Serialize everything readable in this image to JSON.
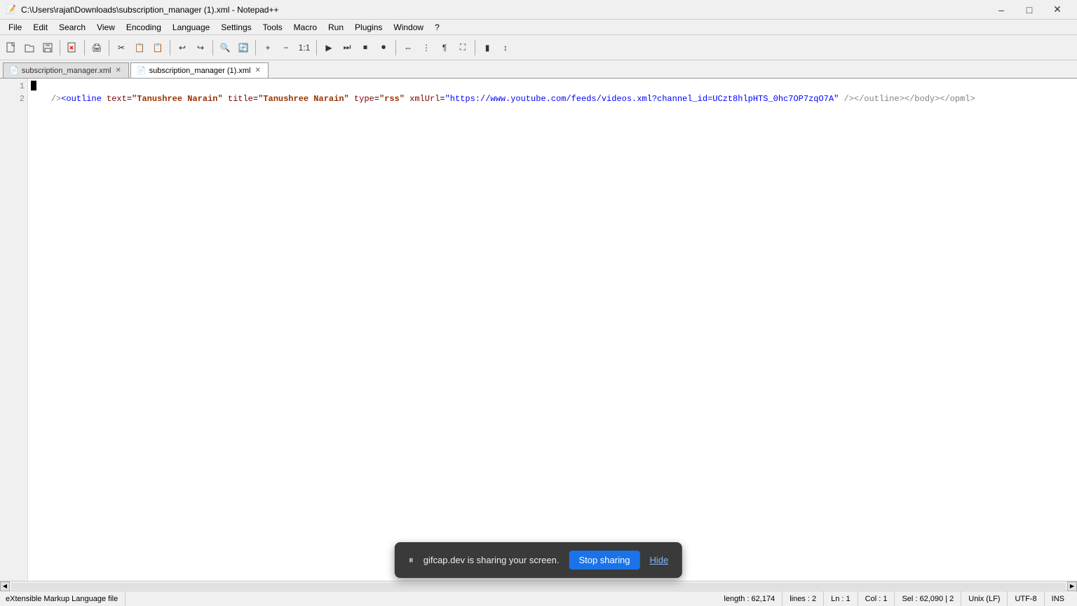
{
  "titleBar": {
    "icon": "📝",
    "title": "C:\\Users\\rajat\\Downloads\\subscription_manager (1).xml - Notepad++",
    "minimizeLabel": "–",
    "maximizeLabel": "□",
    "closeLabel": "✕"
  },
  "menuBar": {
    "items": [
      "File",
      "Edit",
      "Search",
      "View",
      "Encoding",
      "Language",
      "Settings",
      "Tools",
      "Macro",
      "Run",
      "Plugins",
      "Window",
      "?"
    ]
  },
  "tabs": [
    {
      "id": "tab1",
      "label": "subscription_manager.xml",
      "active": false,
      "icon": "📄"
    },
    {
      "id": "tab2",
      "label": "subscription_manager (1).xml",
      "active": true,
      "icon": "📄"
    }
  ],
  "editor": {
    "lines": [
      {
        "num": 1,
        "content": ""
      },
      {
        "num": 2,
        "content": "    /><outline text=\"Tanushree Narain\" title=\"Tanushree Narain\" type=\"rss\" xmlUrl=\"https://www.youtube.com/feeds/videos.xml?channel_id=UCzt8hlpHTS_0hc7OP7zqO7A\" /></outline></body></opml>"
      }
    ]
  },
  "statusBar": {
    "fileType": "eXtensible Markup Language file",
    "length": "length : 62,174",
    "lines": "lines : 2",
    "ln": "Ln : 1",
    "col": "Col : 1",
    "sel": "Sel : 62,090 | 2",
    "lineEnding": "Unix (LF)",
    "encoding": "UTF-8",
    "insertMode": "INS"
  },
  "sharingBanner": {
    "pauseIcon": "⏸",
    "message": "gifcap.dev is sharing your screen.",
    "stopSharingLabel": "Stop sharing",
    "hideLabel": "Hide"
  },
  "toolbar": {
    "buttons": [
      "📄",
      "💾",
      "🖨",
      "✂",
      "📋",
      "📋",
      "↩",
      "↪",
      "🔍",
      "🔍",
      "🔄",
      "🔄",
      "↕",
      "🔖",
      "📑",
      "⬛",
      "▶",
      "⏭",
      "⏹",
      "▶"
    ]
  }
}
